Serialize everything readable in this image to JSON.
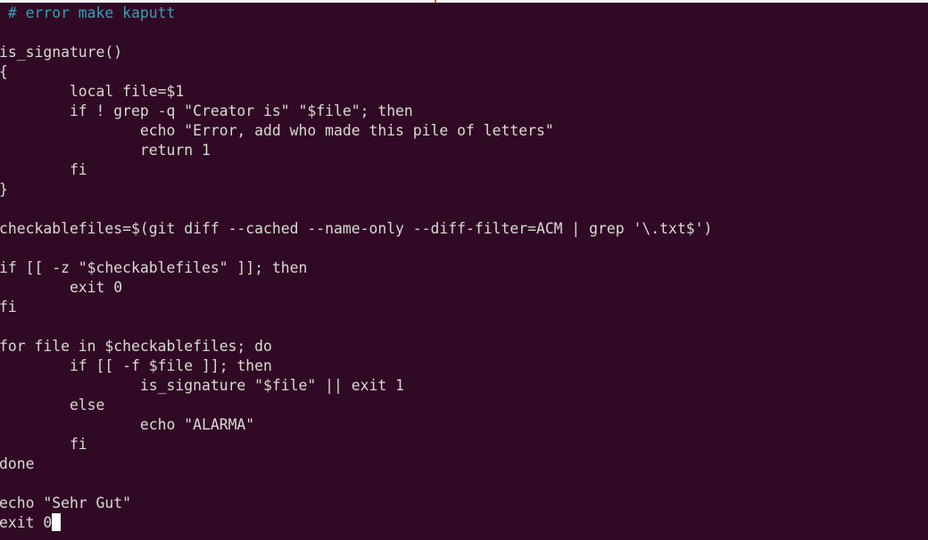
{
  "terminal": {
    "background": "#300a24",
    "comment_color": "#3b9cb6",
    "lines": [
      " # error make kaputt",
      "",
      "is_signature()",
      "{",
      "        local file=$1",
      "        if ! grep -q \"Creator is\" \"$file\"; then",
      "                echo \"Error, add who made this pile of letters\"",
      "                return 1",
      "        fi",
      "}",
      "",
      "checkablefiles=$(git diff --cached --name-only --diff-filter=ACM | grep '\\.txt$')",
      "",
      "if [[ -z \"$checkablefiles\" ]]; then",
      "        exit 0",
      "fi",
      "",
      "for file in $checkablefiles; do",
      "        if [[ -f $file ]]; then",
      "                is_signature \"$file\" || exit 1",
      "        else",
      "                echo \"ALARMA\"",
      "        fi",
      "done",
      "",
      "echo \"Sehr Gut\"",
      "exit 0"
    ]
  }
}
